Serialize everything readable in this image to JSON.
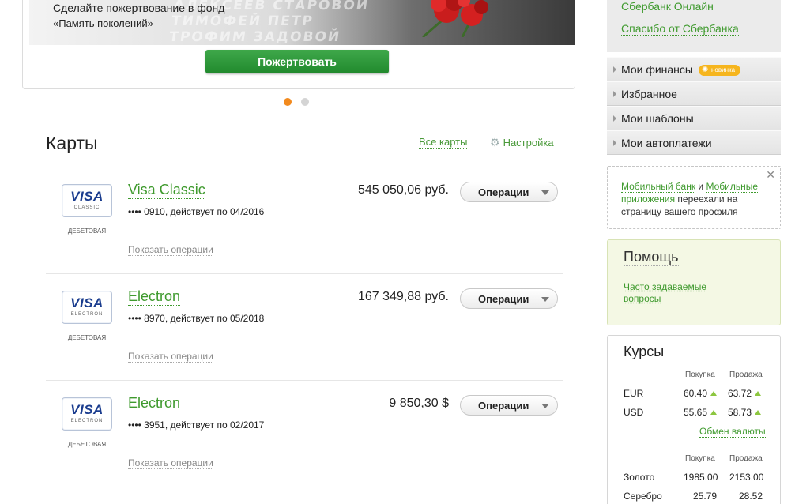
{
  "promo": {
    "text_line1": "Сделайте пожертвование в фонд",
    "text_line2": "«Память поколений»",
    "button_label": "Пожертвовать",
    "wall_line1": "АЛЕКСЕЕВ   СТАРОВОЙ",
    "wall_line2": "ТИМОФЕЙ   ПЕТР",
    "wall_line3": "ТРОФИМ   ЗАДОВОЙ",
    "slides_total": 2,
    "slide_active": 1
  },
  "cards": {
    "title": "Карты",
    "all_cards_label": "Все карты",
    "settings_label": "Настройка",
    "items": [
      {
        "logo": "VISA",
        "logo_sub": "CLASSIC",
        "kind": "ДЕБЕТОВАЯ",
        "name": "Visa Classic",
        "number": "•••• 0910, действует по 04/2016",
        "amount": "545 050,06 руб.",
        "ops_button": "Операции",
        "show_ops": "Показать операции"
      },
      {
        "logo": "VISA",
        "logo_sub": "ELECTRON",
        "kind": "ДЕБЕТОВАЯ",
        "name": "Electron",
        "number": "•••• 8970, действует по 05/2018",
        "amount": "167 349,88 руб.",
        "ops_button": "Операции",
        "show_ops": "Показать операции"
      },
      {
        "logo": "VISA",
        "logo_sub": "ELECTRON",
        "kind": "ДЕБЕТОВАЯ",
        "name": "Electron",
        "number": "•••• 3951, действует по 02/2017",
        "amount": "9 850,30 $",
        "ops_button": "Операции",
        "show_ops": "Показать операции"
      }
    ]
  },
  "sidebar": {
    "links": [
      "Сбербанк Онлайн",
      "Спасибо от Сбербанка"
    ],
    "menu": [
      {
        "label": "Мои финансы",
        "badge": "новинка"
      },
      {
        "label": "Избранное"
      },
      {
        "label": "Мои шаблоны"
      },
      {
        "label": "Мои автоплатежи"
      }
    ],
    "notice": {
      "close": "✕",
      "link1": "Мобильный банк",
      "and": " и ",
      "link2": "Мобильные приложения",
      "rest": " переехали на страницу вашего профиля"
    },
    "help": {
      "title": "Помощь",
      "faq_link": "Часто задаваемые вопросы"
    },
    "rates": {
      "title": "Курсы",
      "col_buy": "Покупка",
      "col_sell": "Продажа",
      "currencies": [
        {
          "code": "EUR",
          "buy": "60.40",
          "sell": "63.72",
          "buy_trend": "up",
          "sell_trend": "up"
        },
        {
          "code": "USD",
          "buy": "55.65",
          "sell": "58.73",
          "buy_trend": "up",
          "sell_trend": "up"
        }
      ],
      "exchange_link": "Обмен валюты",
      "metals_col_buy": "Покупка",
      "metals_col_sell": "Продажа",
      "metals": [
        {
          "name": "Золото",
          "buy": "1985.00",
          "sell": "2153.00"
        },
        {
          "name": "Серебро",
          "buy": "25.79",
          "sell": "28.52"
        }
      ]
    }
  },
  "colors": {
    "accent_green": "#3f9a2e",
    "button_green": "#21892d",
    "carousel_active": "#f28a1e",
    "badge": "#f6b51d",
    "trend_up": "#8cc63f"
  }
}
